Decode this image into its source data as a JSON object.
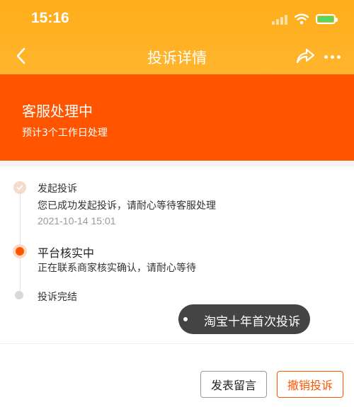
{
  "status_bar": {
    "time": "15:16",
    "icons": [
      "signal-icon",
      "wifi-icon",
      "battery-icon"
    ],
    "battery_color": "#4cd964"
  },
  "nav": {
    "title": "投诉详情",
    "back_icon": "chevron-left-icon",
    "share_icon": "share-icon",
    "more_icon": "more-icon"
  },
  "banner": {
    "title": "客服处理中",
    "subtitle": "预计3个工作日处理",
    "color": "#ff5500"
  },
  "timeline": {
    "steps": [
      {
        "title": "发起投诉",
        "desc": "您已成功发起投诉，请耐心等待客服处理",
        "time": "2021-10-14 15:01",
        "state": "done"
      },
      {
        "title": "平台核实中",
        "desc": "正在联系商家核实确认，请耐心等待",
        "state": "current"
      },
      {
        "title": "投诉完结",
        "state": "pending"
      }
    ]
  },
  "watermark": {
    "text": "淘宝十年首次投诉"
  },
  "actions": {
    "comment_label": "发表留言",
    "cancel_label": "撤销投诉",
    "accent": "#ff5500"
  }
}
